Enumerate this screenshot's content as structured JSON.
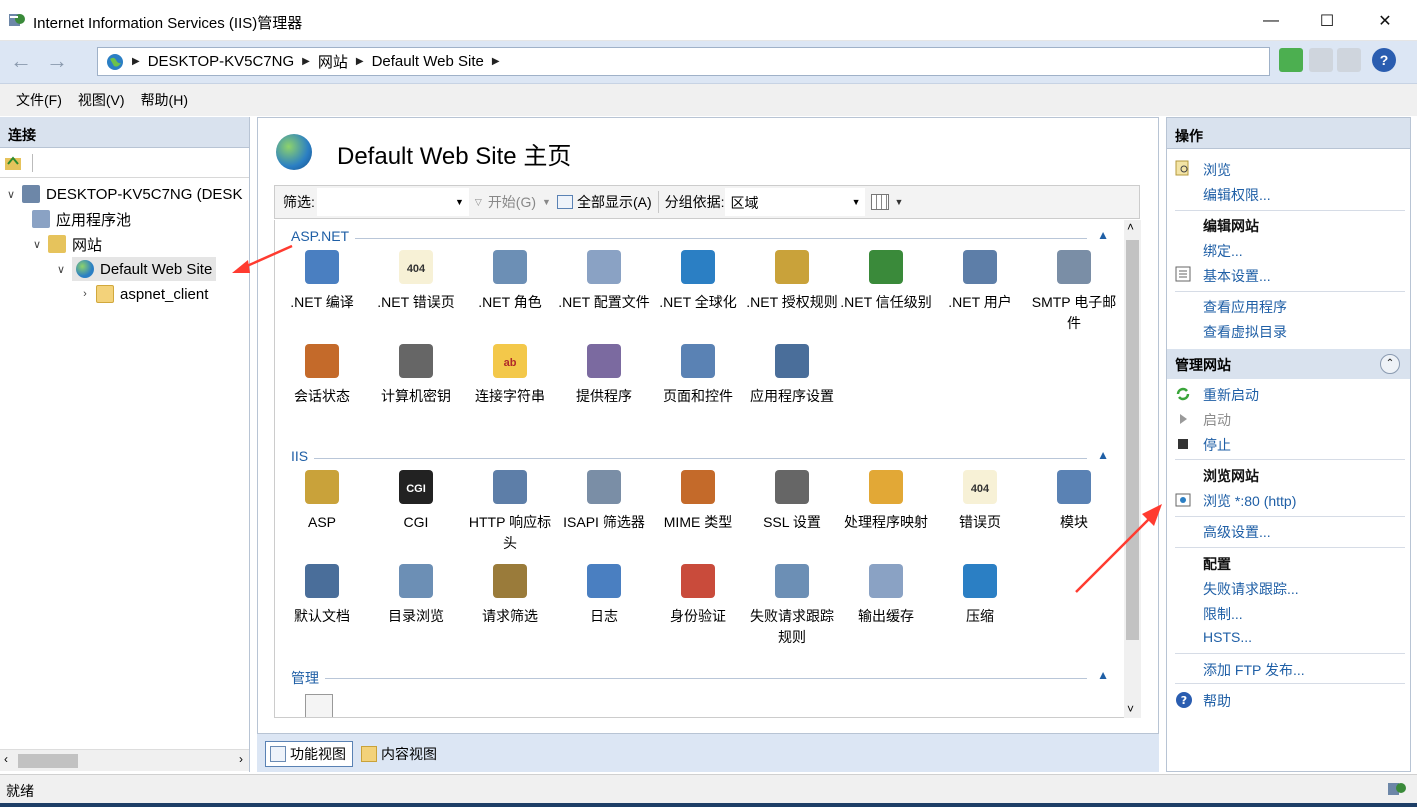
{
  "window": {
    "title": "Internet Information Services (IIS)管理器",
    "minimize": "—",
    "maximize": "☐",
    "close": "✕"
  },
  "address": {
    "crumbs": [
      "DESKTOP-KV5C7NG",
      "网站",
      "Default Web Site"
    ]
  },
  "menu": [
    "文件(F)",
    "视图(V)",
    "帮助(H)"
  ],
  "connections": {
    "header": "连接",
    "tree": [
      {
        "label": "DESKTOP-KV5C7NG (DESK"
      },
      {
        "label": "应用程序池"
      },
      {
        "label": "网站"
      },
      {
        "label": "Default Web Site"
      },
      {
        "label": "aspnet_client"
      }
    ]
  },
  "center": {
    "title": "Default Web Site 主页",
    "filter": {
      "label": "筛选:",
      "start": "开始(G)",
      "show_all": "全部显示(A)",
      "group_label": "分组依据:",
      "group_value": "区域"
    },
    "sections": [
      {
        "name": "ASP.NET"
      },
      {
        "name": "IIS"
      },
      {
        "name": "管理"
      }
    ],
    "aspnet_items": [
      ".NET 编译",
      ".NET 错误页",
      ".NET 角色",
      ".NET 配置文件",
      ".NET 全球化",
      ".NET 授权规则",
      ".NET 信任级别",
      ".NET 用户",
      "SMTP 电子邮件",
      "会话状态",
      "计算机密钥",
      "连接字符串",
      "提供程序",
      "页面和控件",
      "应用程序设置"
    ],
    "iis_items": [
      "ASP",
      "CGI",
      "HTTP 响应标头",
      "ISAPI 筛选器",
      "MIME 类型",
      "SSL 设置",
      "处理程序映射",
      "错误页",
      "模块",
      "默认文档",
      "目录浏览",
      "请求筛选",
      "日志",
      "身份验证",
      "失败请求跟踪规则",
      "输出缓存",
      "压缩"
    ],
    "icon_labels": {
      "error_page": "404",
      "cgi": "CGI",
      "resx": "ab"
    },
    "view_tabs": [
      "功能视图",
      "内容视图"
    ]
  },
  "actions": {
    "header": "操作",
    "browse": "浏览",
    "edit_permissions": "编辑权限...",
    "edit_site": "编辑网站",
    "bindings": "绑定...",
    "basic_settings": "基本设置...",
    "view_apps": "查看应用程序",
    "view_vdirs": "查看虚拟目录",
    "manage_site": "管理网站",
    "restart": "重新启动",
    "start": "启动",
    "stop": "停止",
    "browse_site": "浏览网站",
    "browse_80": "浏览 *:80 (http)",
    "advanced": "高级设置...",
    "config": "配置",
    "failed_req": "失败请求跟踪...",
    "limits": "限制...",
    "hsts": "HSTS...",
    "add_ftp": "添加 FTP 发布...",
    "help": "帮助"
  },
  "status": {
    "text": "就绪"
  },
  "colors": {
    "link": "#1f5fa6",
    "pane_header": "#d9e2ee",
    "annotation_arrow": "#ff3b30"
  }
}
